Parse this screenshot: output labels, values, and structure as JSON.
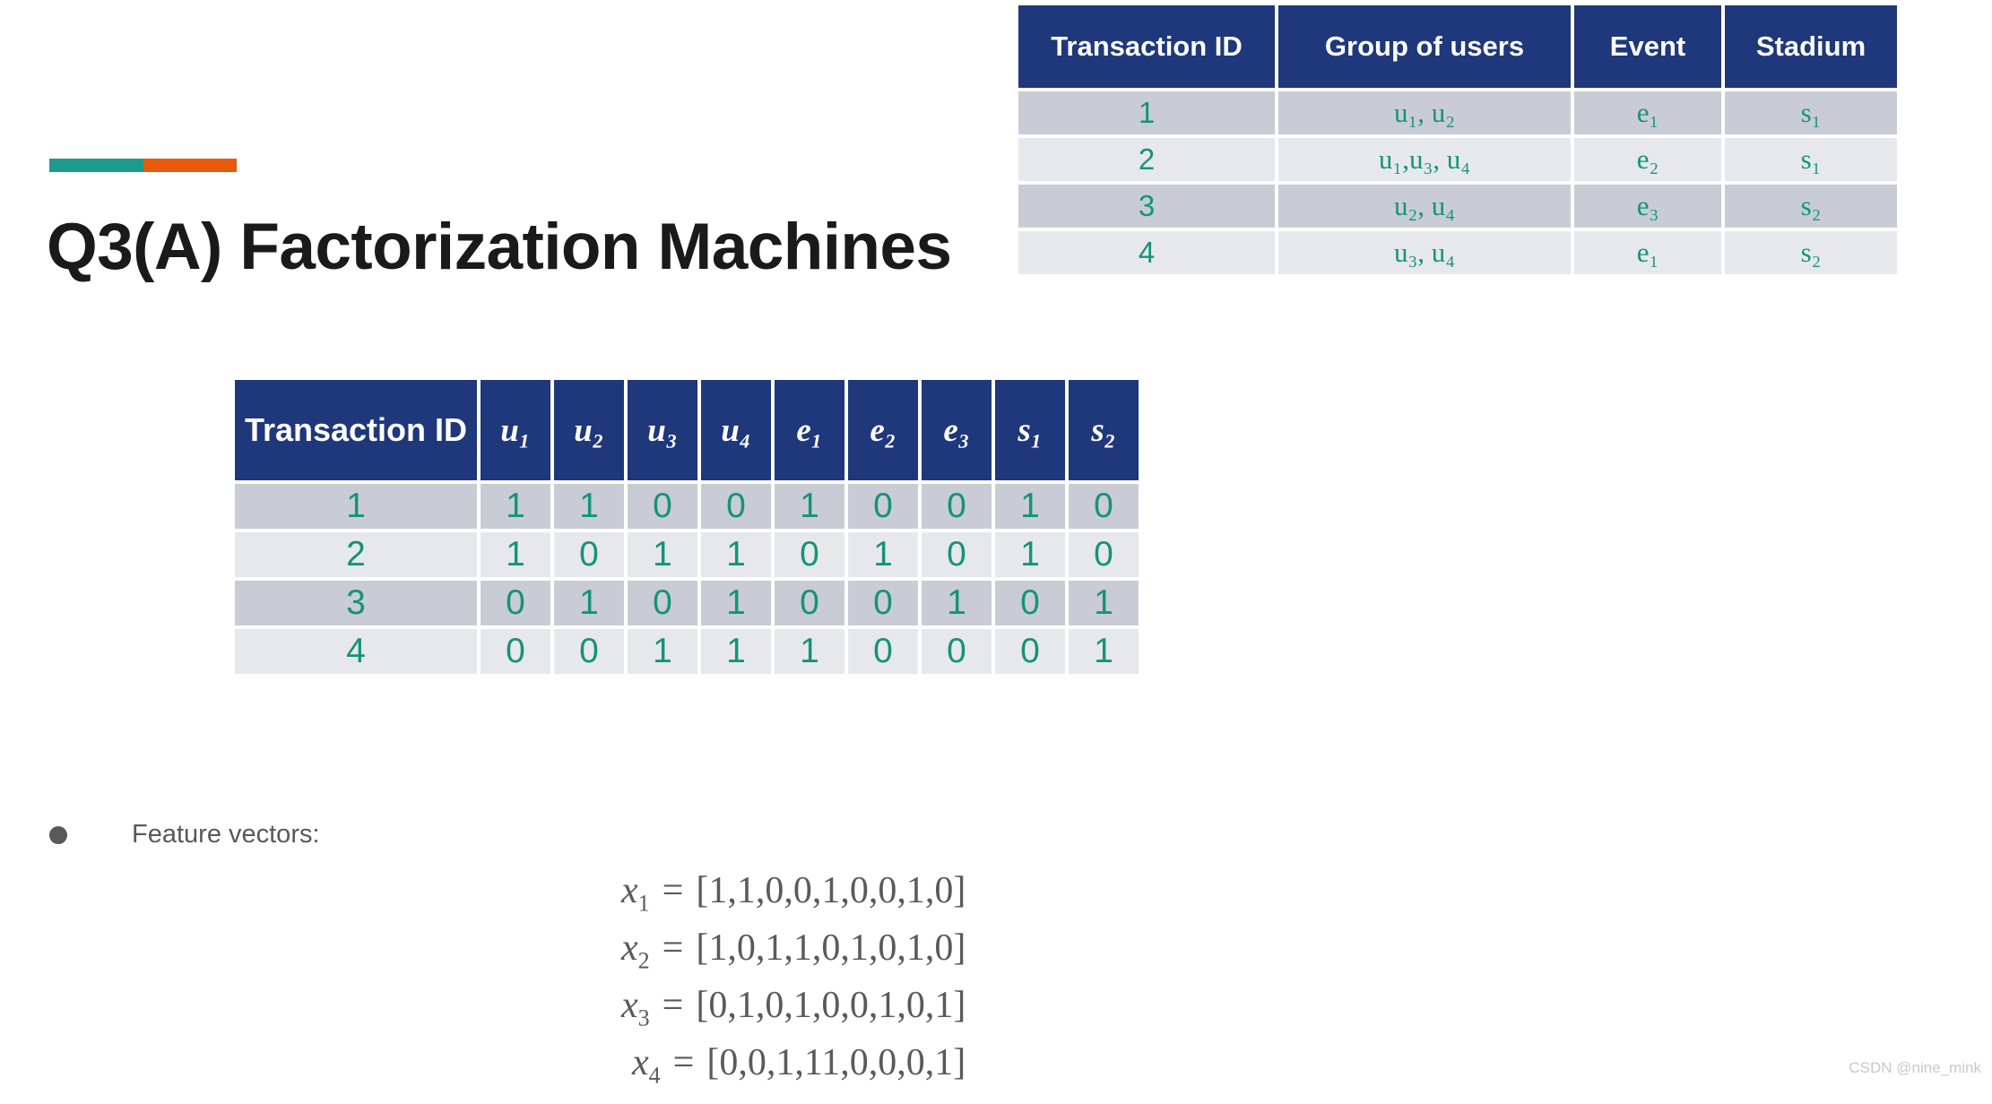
{
  "slide": {
    "title": "Q3(A) Factorization Machines",
    "accent_colors": {
      "teal": "#1C9B8C",
      "orange": "#E8590C"
    },
    "header_blue": "#1F377B",
    "value_teal": "#15937A"
  },
  "transactions_table": {
    "headers": [
      "Transaction ID",
      "Group of users",
      "Event",
      "Stadium"
    ],
    "rows": [
      {
        "id": "1",
        "group": "u₁, u₂",
        "event": "e₁",
        "stadium": "s₁"
      },
      {
        "id": "2",
        "group": "u₁,u₃, u₄",
        "event": "e₂",
        "stadium": "s₁"
      },
      {
        "id": "3",
        "group": "u₂, u₄",
        "event": "e₃",
        "stadium": "s₂"
      },
      {
        "id": "4",
        "group": "u₃, u₄",
        "event": "e₁",
        "stadium": "s₂"
      }
    ]
  },
  "matrix_table": {
    "headers": [
      "Transaction ID",
      "u₁",
      "u₂",
      "u₃",
      "u₄",
      "e₁",
      "e₂",
      "e₃",
      "s₁",
      "s₂"
    ],
    "rows": [
      {
        "id": "1",
        "values": [
          "1",
          "1",
          "0",
          "0",
          "1",
          "0",
          "0",
          "1",
          "0"
        ]
      },
      {
        "id": "2",
        "values": [
          "1",
          "0",
          "1",
          "1",
          "0",
          "1",
          "0",
          "1",
          "0"
        ]
      },
      {
        "id": "3",
        "values": [
          "0",
          "1",
          "0",
          "1",
          "0",
          "0",
          "1",
          "0",
          "1"
        ]
      },
      {
        "id": "4",
        "values": [
          "0",
          "0",
          "1",
          "1",
          "1",
          "0",
          "0",
          "0",
          "1"
        ]
      }
    ]
  },
  "feature_section": {
    "bullet_label": "Feature vectors:",
    "equations": [
      {
        "name": "x",
        "index": "1",
        "eq": "=",
        "value": "[1,1,0,0,1,0,0,1,0]"
      },
      {
        "name": "x",
        "index": "2",
        "eq": "=",
        "value": "[1,0,1,1,0,1,0,1,0]"
      },
      {
        "name": "x",
        "index": "3",
        "eq": "=",
        "value": "[0,1,0,1,0,0,1,0,1]"
      },
      {
        "name": "x",
        "index": "4",
        "eq": "=",
        "value": "[0,0,1,11,0,0,0,1]"
      }
    ]
  },
  "watermark": "CSDN @nine_mink"
}
